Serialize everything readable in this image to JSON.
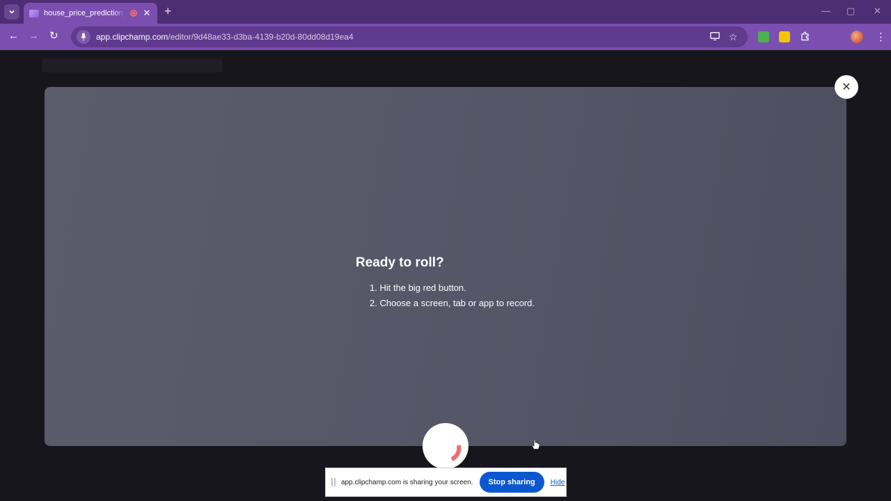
{
  "browser": {
    "tab": {
      "title": "house_price_prediction_video"
    },
    "new_tab_label": "+",
    "window_controls": {
      "minimize": "—",
      "maximize": "▢",
      "close": "✕"
    },
    "nav": {
      "back": "←",
      "forward": "→",
      "reload": "↻"
    },
    "url": {
      "host": "app.clipchamp.com",
      "path": "/editor/9d48ae33-d3ba-4139-b20d-80dd08d19ea4"
    }
  },
  "modal": {
    "title": "Ready to roll?",
    "steps": [
      "1. Hit the big red button.",
      "2. Choose a screen, tab or app to record."
    ],
    "close_label": "✕"
  },
  "share_bar": {
    "message": "app.clipchamp.com is sharing your screen.",
    "stop_label": "Stop sharing",
    "hide_label": "Hide"
  },
  "icons": {
    "tab_list": "chevron-down-icon",
    "recording": "recording-dot-icon",
    "mic": "microphone-icon",
    "cast": "cast-screen-icon",
    "bookmark": "star-icon",
    "extensions": "puzzle-icon",
    "profile": "avatar",
    "menu": "kebab-menu-icon"
  },
  "colors": {
    "chrome_dark": "#4d2d73",
    "chrome_toolbar": "#7b4fb0",
    "stop_button": "#0b57d0",
    "record_arc": "#f26b6b"
  }
}
